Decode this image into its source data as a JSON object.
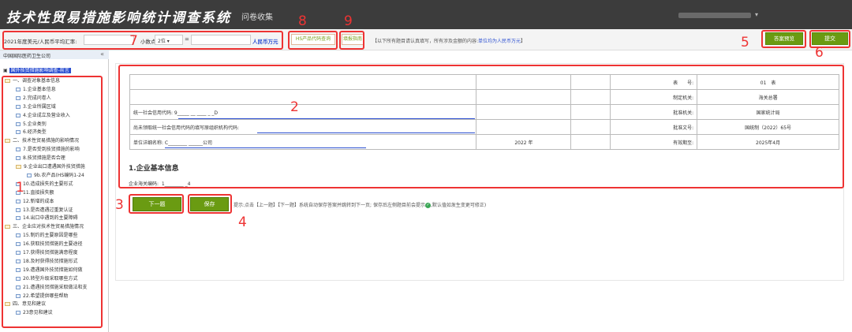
{
  "header": {
    "app_title": "技术性贸易措施影响统计调查系统",
    "nav_label": "问卷收集"
  },
  "toolbar": {
    "rate_label": "2021年度美元/人民币平均汇率:",
    "rate_value": "",
    "decimal_label": "小数点",
    "decimal_value": "2位",
    "eq": "=",
    "amount_value": "",
    "unit_label": "人民币万元",
    "hs_button": "HS产品代码查询",
    "help_button": "填报指南",
    "notice_prefix": "【以下所有题目请认真填写，所有涉及金额的内容:",
    "notice_unit": "单位均为人民币万元",
    "notice_suffix": "】",
    "preview_button": "答案预览",
    "submit_button": "提交"
  },
  "sidebar": {
    "org_name": "中国国际医药卫生公司",
    "collapse": "«",
    "root_label": "国外技贸措施影响调查-前言",
    "items": [
      {
        "label": "一、调查对象基本信息",
        "level": 0,
        "folder": true
      },
      {
        "label": "1.企业基本信息",
        "level": 1
      },
      {
        "label": "2.完成问卷人",
        "level": 1
      },
      {
        "label": "3.企业所属区域",
        "level": 1
      },
      {
        "label": "4.企业成立及营业收入",
        "level": 1
      },
      {
        "label": "5.企业类别",
        "level": 1
      },
      {
        "label": "6.经济类型",
        "level": 1
      },
      {
        "label": "二、技术性贸易措施的影响情况",
        "level": 0,
        "folder": true
      },
      {
        "label": "7.是否受到技贸措施的影响",
        "level": 1
      },
      {
        "label": "8.技贸措施是否合理",
        "level": 1
      },
      {
        "label": "9.企业出口遭遇国外技贸措施",
        "level": 1,
        "folder": true
      },
      {
        "label": "9b.农产品(HS编码1-24",
        "level": 2
      },
      {
        "label": "10.造成损失的主要形式",
        "level": 1
      },
      {
        "label": "11.直接损失额",
        "level": 1
      },
      {
        "label": "12.新增的成本",
        "level": 1
      },
      {
        "label": "13.是否遭遇过重复认证",
        "level": 1
      },
      {
        "label": "14.出口中遇到的主要障碍",
        "level": 1
      },
      {
        "label": "三、企业应对技术性贸易措施情况",
        "level": 0,
        "folder": true
      },
      {
        "label": "15.制约的主要原因是哪些",
        "level": 1
      },
      {
        "label": "16.获取技贸措施的主要途径",
        "level": 1
      },
      {
        "label": "17.获得技贸措施满意程度",
        "level": 1
      },
      {
        "label": "18.及时获得技贸措施形式",
        "level": 1
      },
      {
        "label": "19.遭遇国外技贸措施如何做",
        "level": 1
      },
      {
        "label": "20.转型升级采取哪些方式",
        "level": 1
      },
      {
        "label": "21.遭遇技贸措施采取做法和支",
        "level": 1
      },
      {
        "label": "22.希望提供哪些帮助",
        "level": 1
      },
      {
        "label": "四、意见和建议",
        "level": 0,
        "folder": true
      },
      {
        "label": "23意见和建议",
        "level": 1
      }
    ]
  },
  "form": {
    "rows": [
      {
        "left": "",
        "k": "表　　号:",
        "v": "01　表"
      },
      {
        "left": "",
        "k": "制定机关:",
        "v": "海关总署"
      },
      {
        "left": "统一社会信用代码:  9_____ __ ____ _ _D",
        "k": "批准机关:",
        "v": "国家统计局"
      },
      {
        "left": "尚未领取统一社会信用代码的填写原组织机构代码:",
        "k": "批准文号:",
        "v": "国统制（2022）65号"
      },
      {
        "left": "单位详细名称:  C________ ______公司",
        "mid": "2022 年",
        "k": "有效期至:",
        "v": "2025年4月"
      }
    ],
    "section_title": "1.企业基本信息",
    "customs_code_label": "企业海关编码:",
    "customs_code_value": "1________ _4"
  },
  "actions": {
    "next_button": "下一题",
    "save_button": "保存",
    "hint_text": "提示:点击【上一题】【下一题】系统自动保存答案并跳转到下一页; 保存后左侧题目前会提示",
    "hint_suffix": ",默认值如发生变更可修正)"
  },
  "annotations": [
    "1",
    "2",
    "3",
    "4",
    "5",
    "6",
    "7",
    "8",
    "9"
  ],
  "colors": {
    "accent_green": "#6a9b12",
    "annotation_red": "#ee3333",
    "header_bg": "#3c3c3c",
    "link_blue": "#2b4fd1"
  }
}
